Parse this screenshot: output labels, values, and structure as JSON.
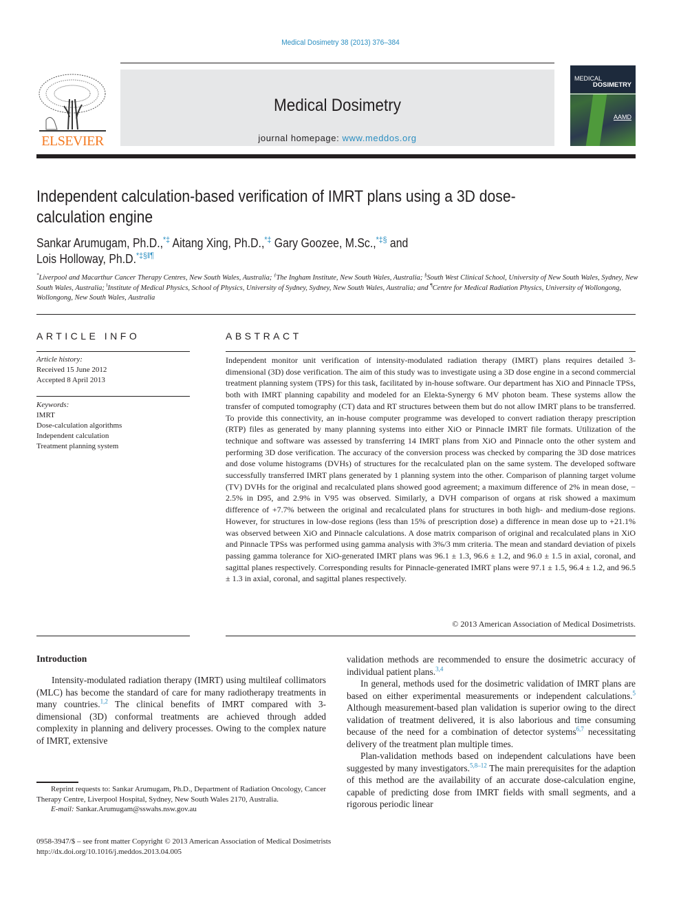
{
  "header": {
    "citation": "Medical Dosimetry 38 (2013) 376–384",
    "journal_name": "Medical Dosimetry",
    "homepage_label": "journal homepage:",
    "homepage_url": "www.meddos.org",
    "publisher": "ELSEVIER",
    "cover": {
      "line1": "MEDICAL",
      "line2": "DOSIMETRY",
      "badge": "AAMD"
    },
    "colors": {
      "link": "#2a8ec1",
      "publisher": "#f47920",
      "banner": "#e6e7e8"
    }
  },
  "article": {
    "title": "Independent calculation-based verification of IMRT plans using a 3D dose-calculation engine",
    "authors": [
      {
        "name": "Sankar Arumugam, Ph.D.,",
        "marks": "*‡"
      },
      {
        "name": "Aitang Xing, Ph.D.,",
        "marks": "*‡"
      },
      {
        "name": "Gary Goozee, M.Sc.,",
        "marks": "*‡§"
      },
      {
        "name": "and",
        "marks": ""
      },
      {
        "name": "Lois Holloway, Ph.D.",
        "marks": "*‡§‖¶"
      }
    ],
    "affiliations": [
      {
        "mark": "*",
        "text": "Liverpool and Macarthur Cancer Therapy Centres, New South Wales, Australia;"
      },
      {
        "mark": "‡",
        "text": "The Ingham Institute, New South Wales, Australia;"
      },
      {
        "mark": "§",
        "text": "South West Clinical School, University of New South Wales, Sydney, New South Wales, Australia;"
      },
      {
        "mark": "‖",
        "text": "Institute of Medical Physics, School of Physics, University of Sydney, Sydney, New South Wales, Australia; and"
      },
      {
        "mark": "¶",
        "text": "Centre for Medical Radiation Physics, University of Wollongong, Wollongong, New South Wales, Australia"
      }
    ]
  },
  "article_info": {
    "heading": "ARTICLE INFO",
    "history_label": "Article history:",
    "received": "Received 15 June 2012",
    "accepted": "Accepted 8 April 2013",
    "keywords_label": "Keywords:",
    "keywords": [
      "IMRT",
      "Dose-calculation algorithms",
      "Independent calculation",
      "Treatment planning system"
    ]
  },
  "abstract": {
    "heading": "ABSTRACT",
    "text": "Independent monitor unit verification of intensity-modulated radiation therapy (IMRT) plans requires detailed 3-dimensional (3D) dose verification. The aim of this study was to investigate using a 3D dose engine in a second commercial treatment planning system (TPS) for this task, facilitated by in-house software. Our department has XiO and Pinnacle TPSs, both with IMRT planning capability and modeled for an Elekta-Synergy 6 MV photon beam. These systems allow the transfer of computed tomography (CT) data and RT structures between them but do not allow IMRT plans to be transferred. To provide this connectivity, an in-house computer programme was developed to convert radiation therapy prescription (RTP) files as generated by many planning systems into either XiO or Pinnacle IMRT file formats. Utilization of the technique and software was assessed by transferring 14 IMRT plans from XiO and Pinnacle onto the other system and performing 3D dose verification. The accuracy of the conversion process was checked by comparing the 3D dose matrices and dose volume histograms (DVHs) of structures for the recalculated plan on the same system. The developed software successfully transferred IMRT plans generated by 1 planning system into the other. Comparison of planning target volume (TV) DVHs for the original and recalculated plans showed good agreement; a maximum difference of 2% in mean dose, − 2.5% in D95, and 2.9% in V95 was observed. Similarly, a DVH comparison of organs at risk showed a maximum difference of +7.7% between the original and recalculated plans for structures in both high- and medium-dose regions. However, for structures in low-dose regions (less than 15% of prescription dose) a difference in mean dose up to +21.1% was observed between XiO and Pinnacle calculations. A dose matrix comparison of original and recalculated plans in XiO and Pinnacle TPSs was performed using gamma analysis with 3%/3 mm criteria. The mean and standard deviation of pixels passing gamma tolerance for XiO-generated IMRT plans was 96.1 ± 1.3, 96.6 ± 1.2, and 96.0 ± 1.5 in axial, coronal, and sagittal planes respectively. Corresponding results for Pinnacle-generated IMRT plans were 97.1 ± 1.5, 96.4 ± 1.2, and 96.5 ± 1.3 in axial, coronal, and sagittal planes respectively.",
    "copyright": "© 2013 American Association of Medical Dosimetrists."
  },
  "introduction": {
    "heading": "Introduction",
    "col1": {
      "p1_a": "Intensity-modulated radiation therapy (IMRT) using multileaf collimators (MLC) has become the standard of care for many radiotherapy treatments in many countries.",
      "p1_ref": "1,2",
      "p1_b": " The clinical benefits of IMRT compared with 3-dimensional (3D) conformal treatments are achieved through added complexity in planning and delivery processes. Owing to the complex nature of IMRT, extensive"
    },
    "col2": {
      "p1_a": "validation methods are recommended to ensure the dosimetric accuracy of individual patient plans.",
      "p1_ref": "3,4",
      "p2_a": "In general, methods used for the dosimetric validation of IMRT plans are based on either experimental measurements or independent calculations.",
      "p2_ref1": "5",
      "p2_b": " Although measurement-based plan validation is superior owing to the direct validation of treatment delivered, it is also laborious and time consuming because of the need for a combination of detector systems",
      "p2_ref2": "6,7",
      "p2_c": " necessitating delivery of the treatment plan multiple times.",
      "p3_a": "Plan-validation methods based on independent calculations have been suggested by many investigators.",
      "p3_ref": "5,8–12",
      "p3_b": " The main prerequisites for the adaption of this method are the availability of an accurate dose-calculation engine, capable of predicting dose from IMRT fields with small segments, and a rigorous periodic linear"
    }
  },
  "footnote": {
    "reprint": "Reprint requests to: Sankar Arumugam, Ph.D., Department of Radiation Oncology, Cancer Therapy Centre, Liverpool Hospital, Sydney, New South Wales 2170, Australia.",
    "email_label": "E-mail:",
    "email": "Sankar.Arumugam@sswahs.nsw.gov.au"
  },
  "bottom": {
    "issn_line": "0958-3947/$ – see front matter Copyright © 2013 American Association of Medical Dosimetrists",
    "doi": "http://dx.doi.org/10.1016/j.meddos.2013.04.005"
  }
}
